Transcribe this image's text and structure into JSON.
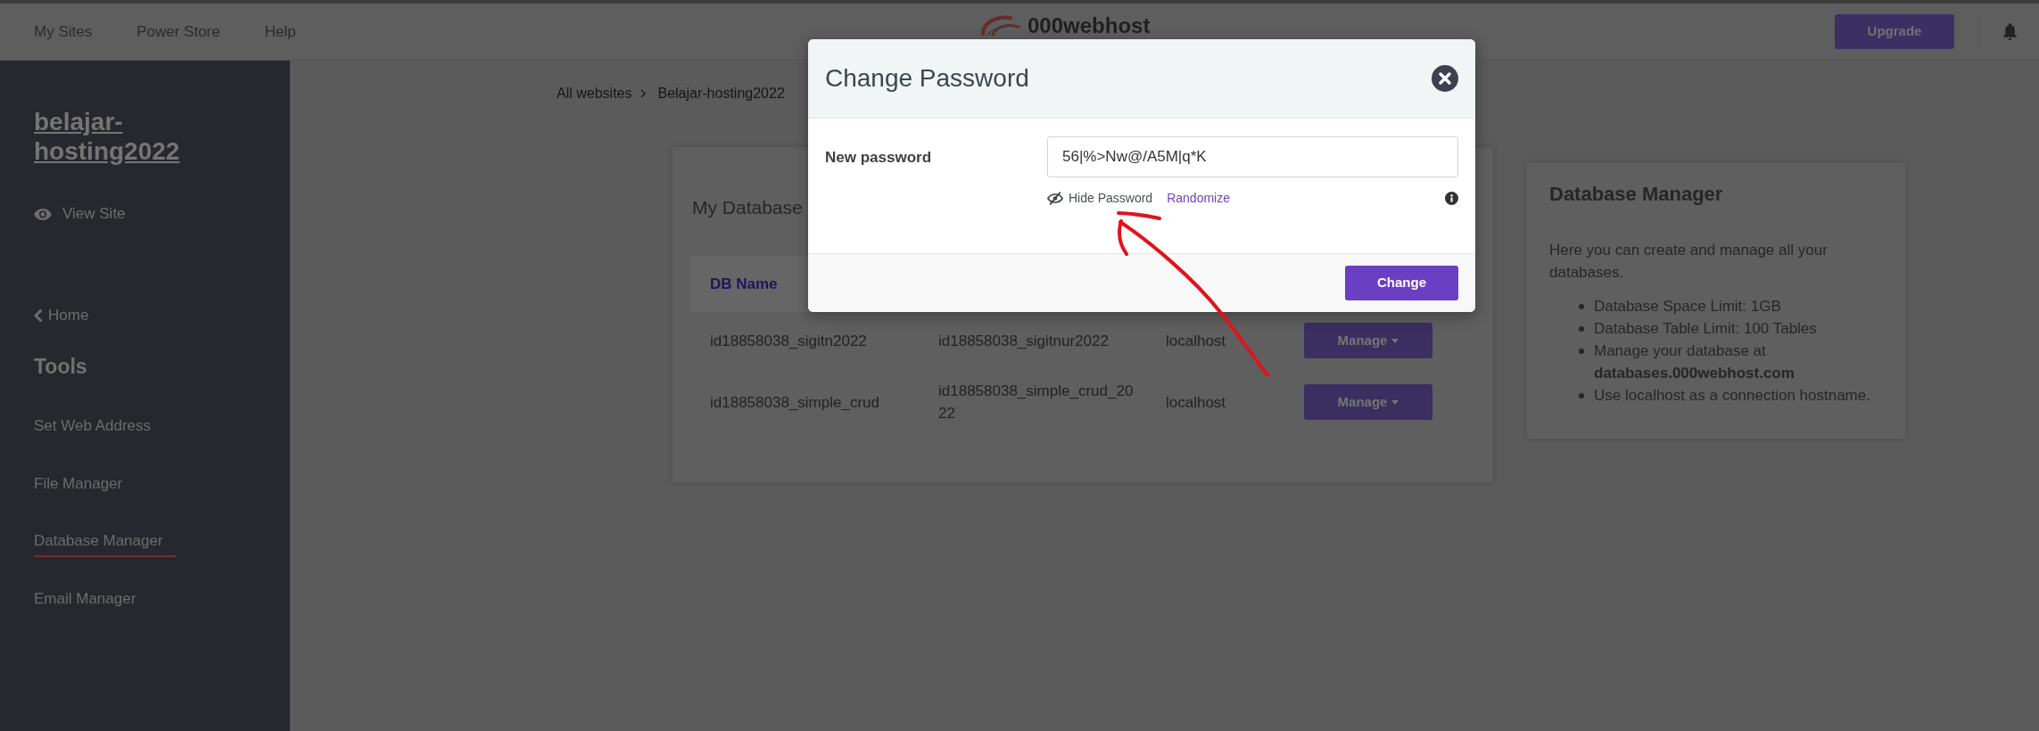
{
  "top_bar": {
    "nav_links": [
      "My Sites",
      "Power Store",
      "Help"
    ],
    "logo_text": "000webhost",
    "upgrade_button": "Upgrade"
  },
  "sidebar": {
    "site_title": "belajar-hosting2022",
    "view_site": "View Site",
    "home": "Home",
    "section_title": "Tools",
    "items": [
      {
        "label": "Set Web Address",
        "selected": false
      },
      {
        "label": "File Manager",
        "selected": false
      },
      {
        "label": "Database Manager",
        "selected": true
      },
      {
        "label": "Email Manager",
        "selected": false
      }
    ]
  },
  "breadcrumb": [
    "All websites",
    "Belajar-hosting2022"
  ],
  "databases_card": {
    "title": "My Database",
    "columns": [
      "DB Name"
    ],
    "rows": [
      {
        "db_name": "id18858038_sigitn2022",
        "column_2": "id18858038_sigitnur2022",
        "column_3": "localhost",
        "action": "Manage"
      },
      {
        "db_name": "id18858038_simple_crud",
        "column_2": "id18858038_simple_crud_2022",
        "column_3": "localhost",
        "action": "Manage"
      }
    ]
  },
  "info_card": {
    "title": "Database Manager",
    "description": "Here you can create and manage all your databases.",
    "bullets": [
      "Database Space Limit: 1GB",
      "Database Table Limit: 100 Tables",
      "Manage your database at **databases.000webhost.com**",
      "Use localhost as a connection hostname."
    ]
  },
  "modal": {
    "title": "Change Password",
    "field_label": "New password",
    "field_value": "56|%>Nw@/A5M|q*K",
    "hide_password": "Hide Password",
    "randomize": "Randomize",
    "submit_button": "Change"
  },
  "annotations": [
    {
      "kind": "callout"
    }
  ]
}
